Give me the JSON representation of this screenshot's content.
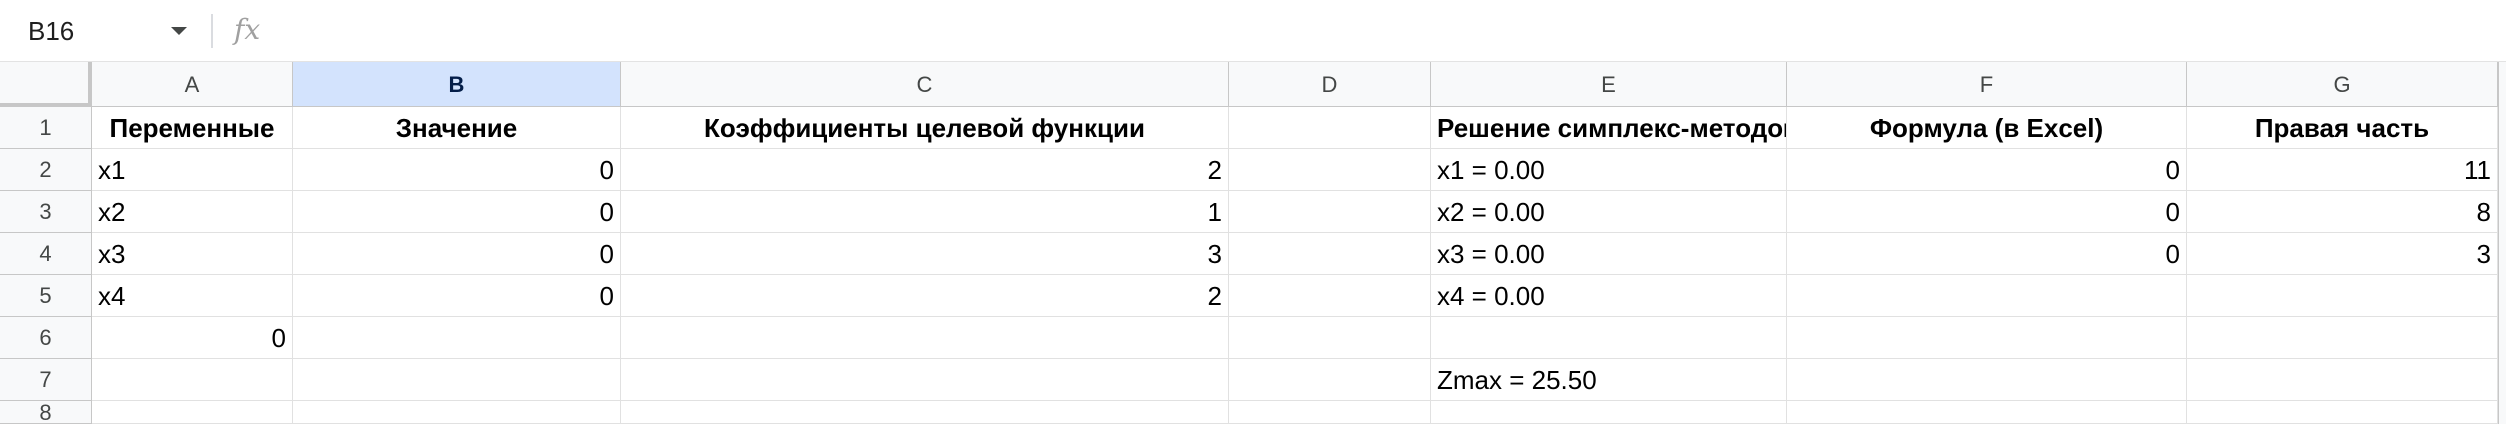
{
  "formula_bar": {
    "name_box": "B16",
    "fx_symbol": "fx",
    "formula": ""
  },
  "columns": [
    "A",
    "B",
    "C",
    "D",
    "E",
    "F",
    "G"
  ],
  "selected_column": "B",
  "rows": [
    "1",
    "2",
    "3",
    "4",
    "5",
    "6",
    "7",
    "8"
  ],
  "cells": {
    "A1": "Переменные",
    "B1": "Значение",
    "C1": "Коэффициенты целевой функции",
    "D1": "",
    "E1": "Решение симплекс-методом",
    "F1": "Формула (в Excel)",
    "G1": "Правая часть",
    "A2": "x1",
    "B2": "0",
    "C2": "2",
    "D2": "",
    "E2": "x1 = 0.00",
    "F2": "0",
    "G2": "11",
    "A3": "x2",
    "B3": "0",
    "C3": "1",
    "D3": "",
    "E3": "x2 = 0.00",
    "F3": "0",
    "G3": "8",
    "A4": "x3",
    "B4": "0",
    "C4": "3",
    "D4": "",
    "E4": "x3 = 0.00",
    "F4": "0",
    "G4": "3",
    "A5": "x4",
    "B5": "0",
    "C5": "2",
    "D5": "",
    "E5": "x4 = 0.00",
    "F5": "",
    "G5": "",
    "A6": "0",
    "B6": "",
    "C6": "",
    "D6": "",
    "E6": "",
    "F6": "",
    "G6": "",
    "A7": "",
    "B7": "",
    "C7": "",
    "D7": "",
    "E7": "Zmax = 25.50",
    "F7": "",
    "G7": "",
    "A8": "",
    "B8": "",
    "C8": "",
    "D8": "",
    "E8": "",
    "F8": "",
    "G8": ""
  }
}
